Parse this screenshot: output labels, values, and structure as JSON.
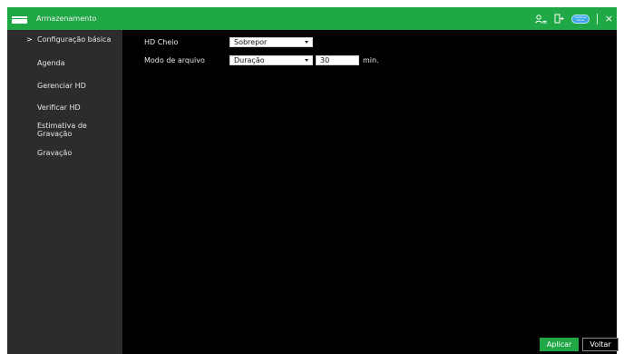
{
  "titlebar": {
    "title": "Armazenamento",
    "cloud_label": "Intelbras Cloud",
    "close_glyph": "×",
    "icons": [
      "storage-icon",
      "user-icon",
      "logout-icon",
      "cloud-icon",
      "close-icon"
    ]
  },
  "sidebar": {
    "active_marker": ">",
    "items": [
      {
        "label": "Configuração básica"
      },
      {
        "label": "Agenda"
      },
      {
        "label": "Gerenciar HD"
      },
      {
        "label": "Verificar HD"
      },
      {
        "label": "Estimativa de Gravação"
      },
      {
        "label": "Gravação"
      }
    ]
  },
  "form": {
    "hd_full": {
      "label": "HD Cheio",
      "value": "Sobrepor"
    },
    "file_mode": {
      "label": "Modo de arquivo",
      "value": "Duração",
      "duration_value": "30",
      "unit": "min."
    }
  },
  "buttons": {
    "apply": "Aplicar",
    "back": "Voltar"
  },
  "colors": {
    "accent_green": "#1fa845",
    "sidebar_bg": "#2c2c2c",
    "content_bg": "#000000"
  }
}
